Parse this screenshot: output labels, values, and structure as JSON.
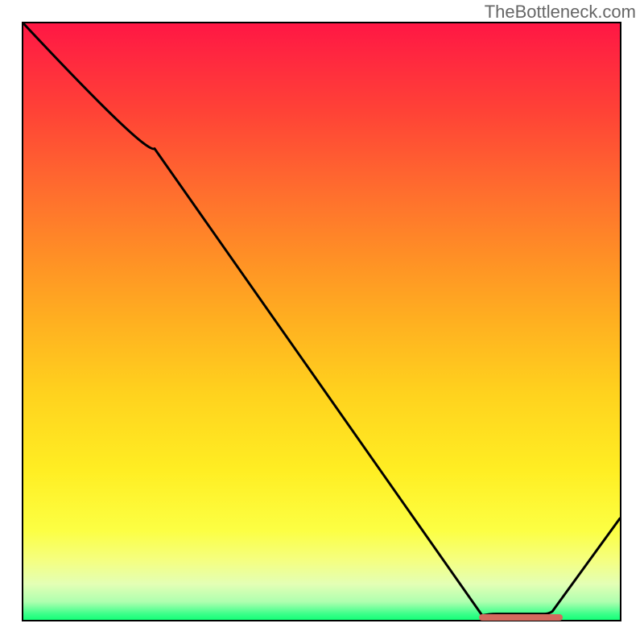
{
  "attribution": "TheBottleneck.com",
  "chart_data": {
    "type": "line",
    "title": "",
    "xlabel": "",
    "ylabel": "",
    "xlim": [
      0,
      100
    ],
    "ylim": [
      0,
      100
    ],
    "curve": [
      {
        "x": 0,
        "y": 100
      },
      {
        "x": 22,
        "y": 79
      },
      {
        "x": 78,
        "y": 1
      },
      {
        "x": 88,
        "y": 1
      },
      {
        "x": 100,
        "y": 17
      }
    ],
    "marker_range": {
      "start": 76,
      "end": 90,
      "y": 1
    },
    "gradient_stops": [
      {
        "pct": 0,
        "color": "#ff1744"
      },
      {
        "pct": 50,
        "color": "#ffb020"
      },
      {
        "pct": 85,
        "color": "#fcff43"
      },
      {
        "pct": 100,
        "color": "#15ff77"
      }
    ]
  }
}
